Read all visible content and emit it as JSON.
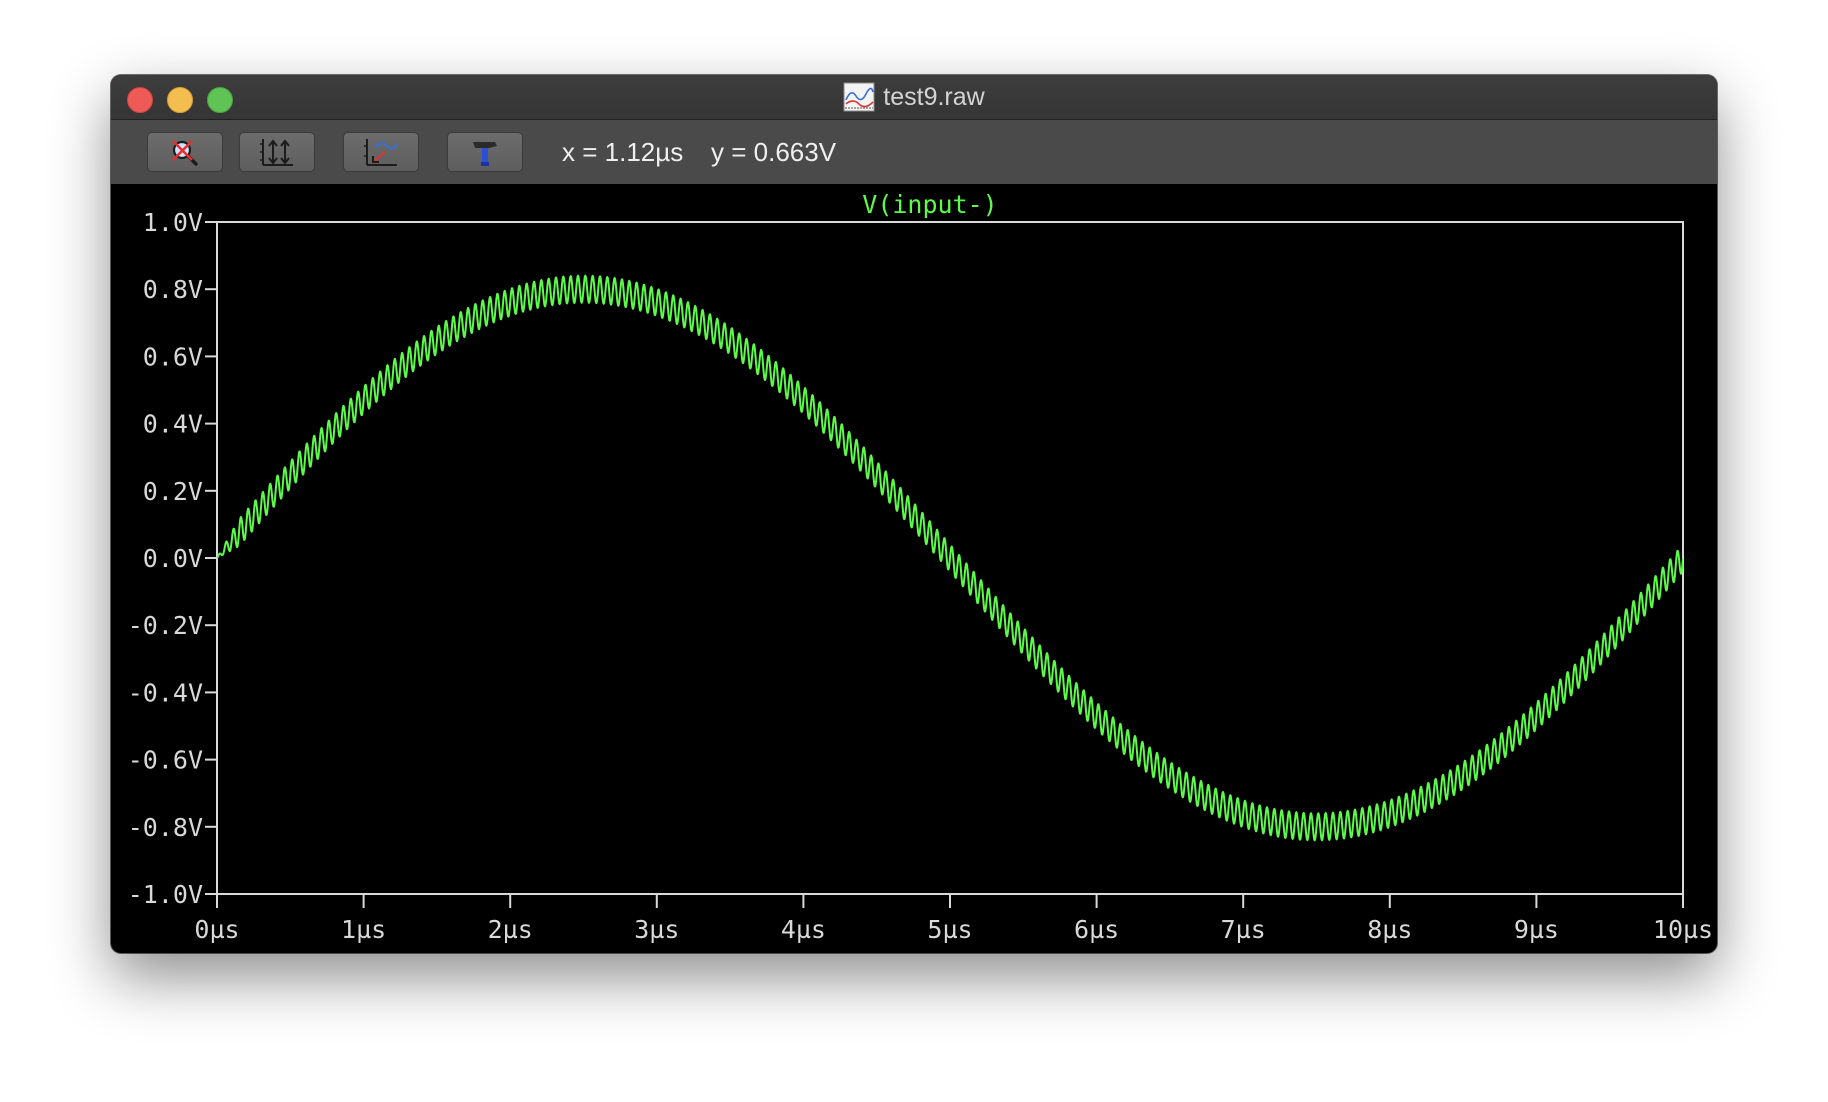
{
  "window": {
    "title": "test9.raw",
    "title_icon": "waveform-file-icon"
  },
  "toolbar": {
    "buttons": [
      {
        "name": "zoom-cancel-button",
        "icon": "magnifier-cross-icon"
      },
      {
        "name": "autorange-y-button",
        "icon": "vertical-autorange-icon"
      },
      {
        "name": "autorange-x-button",
        "icon": "zoom-to-fit-icon"
      },
      {
        "name": "properties-button",
        "icon": "hammer-icon"
      }
    ],
    "cursor_x": "x = 1.12µs",
    "cursor_y": "y = 0.663V"
  },
  "chart_data": {
    "type": "line",
    "title": "V(input-)",
    "xlabel": "",
    "ylabel": "",
    "xlim": [
      0,
      10
    ],
    "ylim": [
      -1.0,
      1.0
    ],
    "x_tick_labels": [
      "0µs",
      "1µs",
      "2µs",
      "3µs",
      "4µs",
      "5µs",
      "6µs",
      "7µs",
      "8µs",
      "9µs",
      "10µs"
    ],
    "y_tick_labels": [
      "1.0V",
      "0.8V",
      "0.6V",
      "0.4V",
      "0.2V",
      "0.0V",
      "-0.2V",
      "-0.4V",
      "-0.6V",
      "-0.8V",
      "-1.0V"
    ],
    "series": [
      {
        "name": "V(input-)",
        "color": "#5cfb4a",
        "description_values": {
          "x_us": [
            0,
            0.5,
            1.0,
            1.5,
            2.0,
            2.5,
            3.0,
            3.5,
            4.0,
            4.5,
            5.0,
            5.5,
            6.0,
            6.5,
            7.0,
            7.5,
            8.0,
            8.5,
            9.0,
            9.5,
            10.0
          ],
          "y_center_v": [
            0.0,
            0.25,
            0.48,
            0.65,
            0.76,
            0.8,
            0.76,
            0.65,
            0.47,
            0.25,
            0.0,
            -0.25,
            -0.47,
            -0.65,
            -0.76,
            -0.8,
            -0.76,
            -0.65,
            -0.47,
            -0.25,
            0.0
          ]
        },
        "ripple_amplitude_v": 0.04,
        "ripple_cycles": 200
      }
    ],
    "grid": false,
    "background": "#000000",
    "axis_color": "#d9d9d9"
  }
}
